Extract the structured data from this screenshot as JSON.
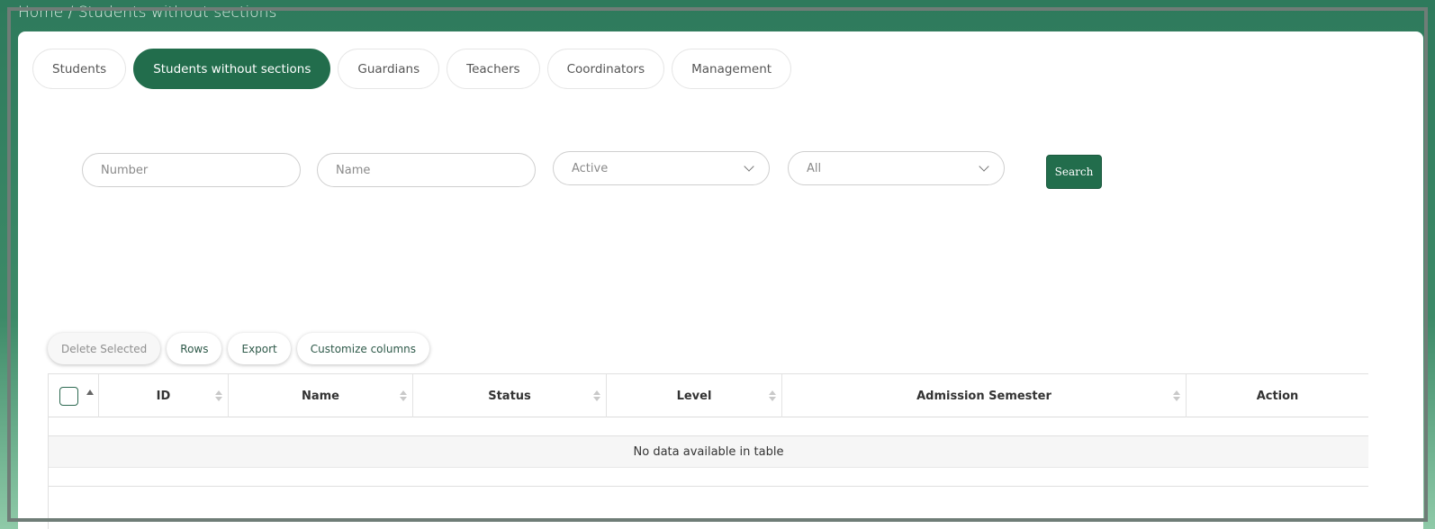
{
  "breadcrumb": "Home / Students without sections",
  "tabs": [
    {
      "label": "Students"
    },
    {
      "label": "Students without sections"
    },
    {
      "label": "Guardians"
    },
    {
      "label": "Teachers"
    },
    {
      "label": "Coordinators"
    },
    {
      "label": "Management"
    }
  ],
  "filters": {
    "number_placeholder": "Number",
    "name_placeholder": "Name",
    "status_value": "Active",
    "level_value": "All",
    "search_label": "Search"
  },
  "toolbar": {
    "delete_selected": "Delete Selected",
    "rows": "Rows",
    "export": "Export",
    "customize_columns": "Customize columns"
  },
  "table": {
    "columns": [
      "ID",
      "Name",
      "Status",
      "Level",
      "Admission Semester",
      "Action"
    ],
    "empty_message": "No data available in table"
  },
  "colors": {
    "accent": "#226d4c"
  }
}
